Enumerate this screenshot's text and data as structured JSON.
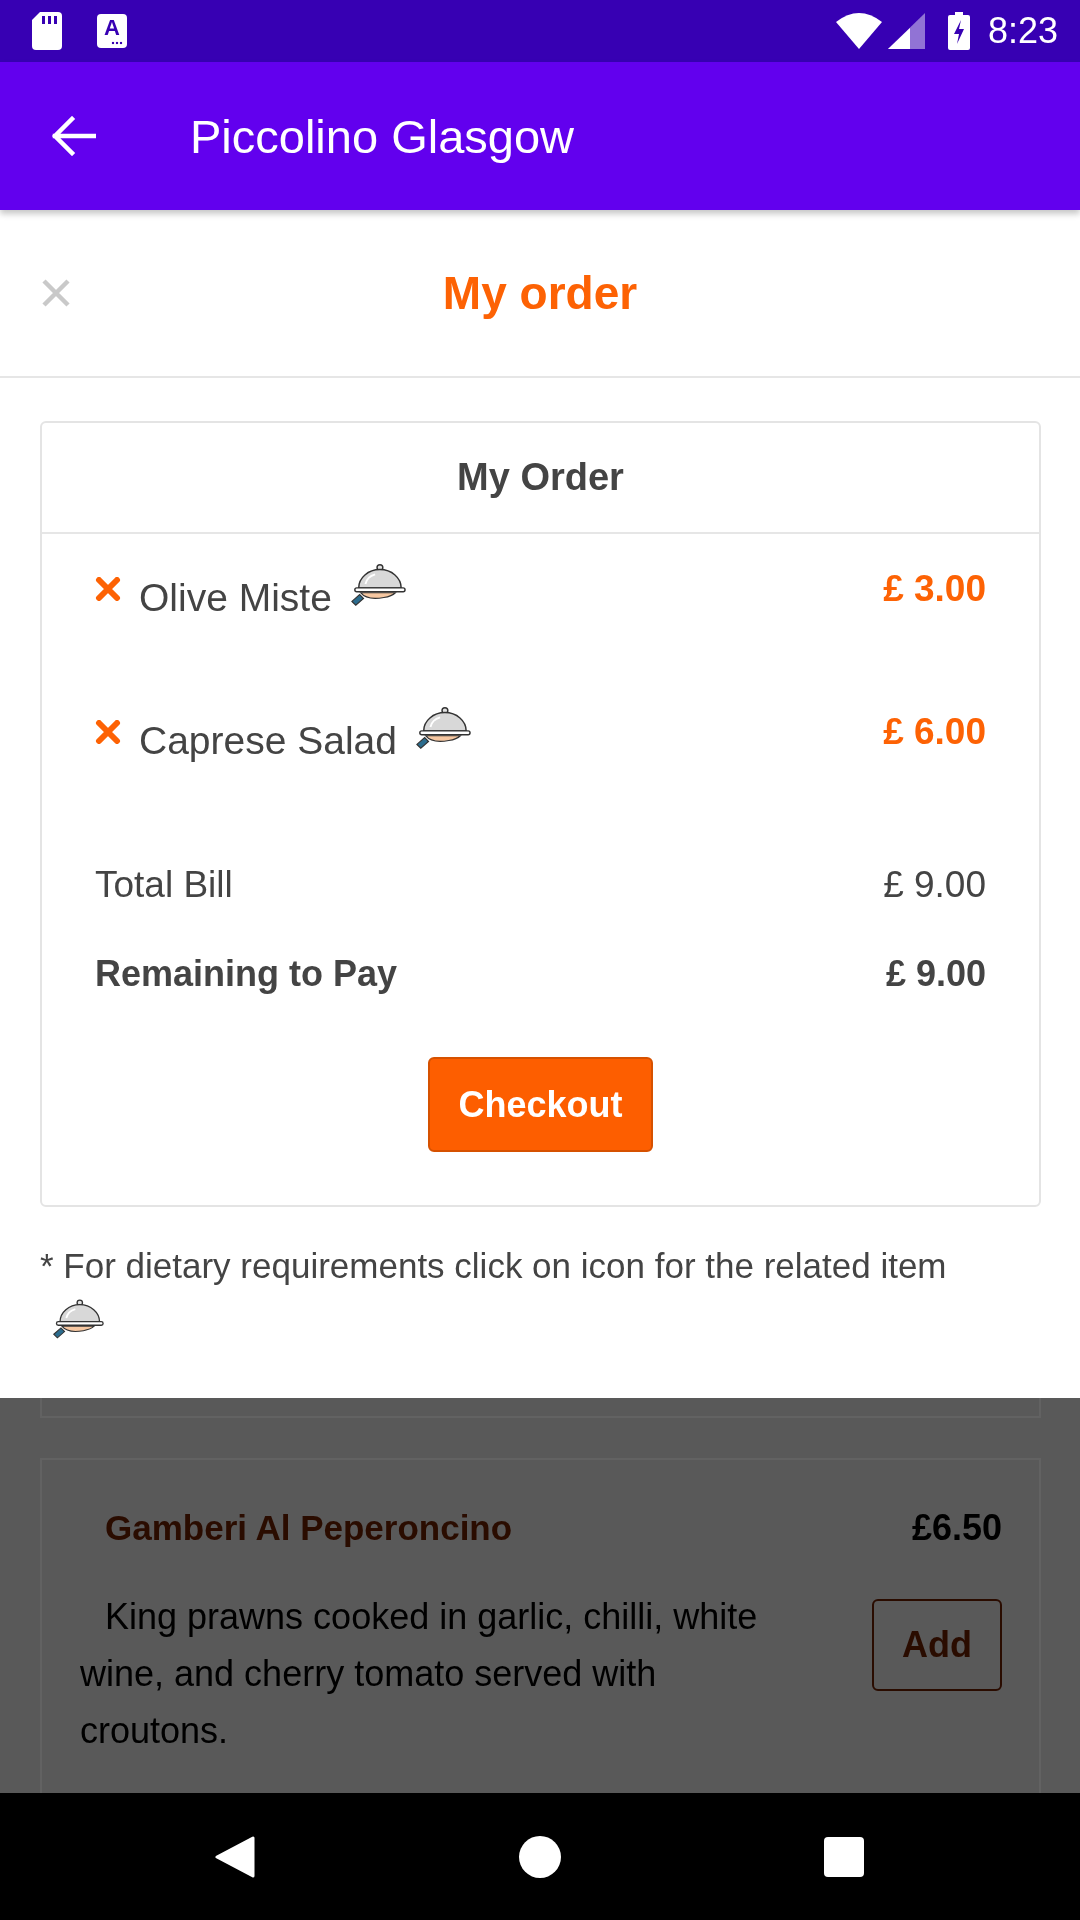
{
  "status_bar": {
    "notification_letter": "A",
    "time": "8:23"
  },
  "app_bar": {
    "title": "Piccolino Glasgow"
  },
  "order_sheet": {
    "title": "My order",
    "card": {
      "title": "My Order",
      "items": [
        {
          "name": "Olive Miste",
          "price": "£ 3.00"
        },
        {
          "name": "Caprese Salad",
          "price": "£ 6.00"
        }
      ],
      "totals": [
        {
          "kind": "plain",
          "label": "Total Bill",
          "value": "£ 9.00"
        },
        {
          "kind": "strong",
          "label": "Remaining to Pay",
          "value": "£ 9.00"
        }
      ],
      "checkout_button": "Checkout"
    },
    "note": "* For dietary requirements click on icon for the related item"
  },
  "menu_behind": {
    "items": [
      {
        "name": "Gamberi Al Peperoncino",
        "price": "£6.50",
        "description": "King prawns cooked in garlic, chilli, white wine, and cherry tomato served with croutons.",
        "add_button": "Add"
      }
    ]
  }
}
